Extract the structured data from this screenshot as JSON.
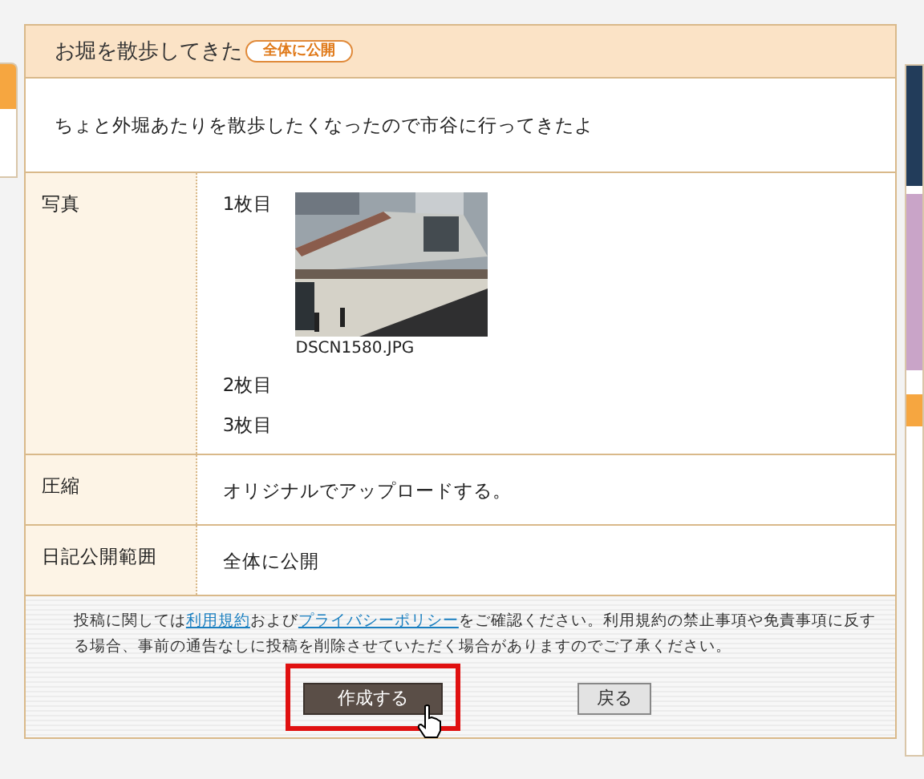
{
  "entry": {
    "title": "お堀を散歩してきた",
    "visibility_badge": "全体に公開",
    "body": "ちょと外堀あたりを散歩したくなったので市谷に行ってきたよ"
  },
  "rows": [
    {
      "kind": "photos",
      "label": "写真",
      "photos": [
        {
          "label": "1枚目",
          "kind": "picture",
          "filename": "DSCN1580.JPG"
        },
        {
          "label": "2枚目"
        },
        {
          "label": "3枚目"
        }
      ]
    },
    {
      "kind": "text",
      "label": "圧縮",
      "value": "オリジナルでアップロードする。"
    },
    {
      "kind": "text",
      "label": "日記公開範囲",
      "value": "全体に公開"
    }
  ],
  "notice": {
    "before": "投稿に関しては",
    "link1": "利用規約",
    "middle": "および",
    "link2": "プライバシーポリシー",
    "after": "をご確認ください。利用規約の禁止事項や免責事項に反する場合、事前の通告なしに投稿を削除させていただく場合がありますのでご了承ください。"
  },
  "buttons": [
    {
      "label": "作成する",
      "kind": "primary",
      "highlighted": true
    },
    {
      "label": "戻る",
      "kind": "secondary",
      "highlighted": false
    }
  ]
}
